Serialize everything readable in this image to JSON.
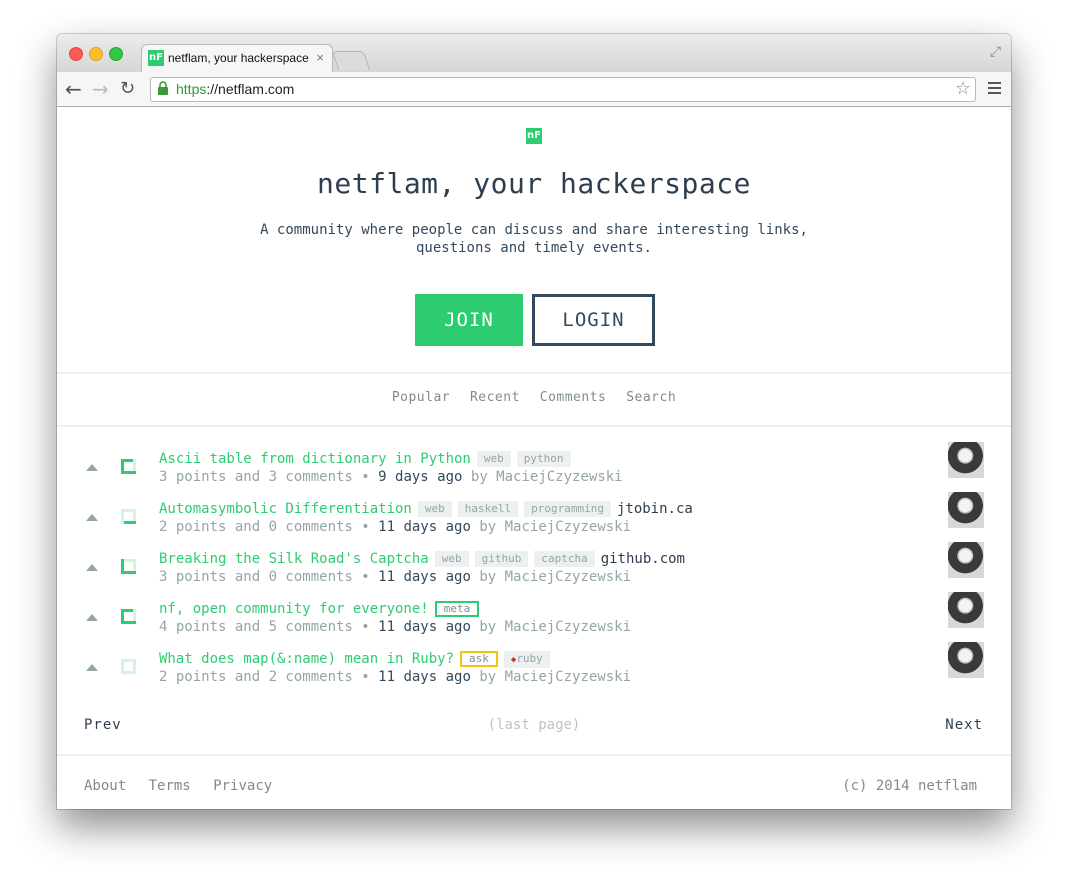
{
  "browser": {
    "tab_title": "netflam, your hackerspace",
    "tab_favicon": "nF",
    "tab_close": "×",
    "url_scheme": "https",
    "url_rest": "://netflam.com"
  },
  "hero": {
    "logo": "nF",
    "title": "netflam, your hackerspace",
    "tagline": "A community where people can discuss and share interesting links, questions and timely events.",
    "join_label": "JOIN",
    "login_label": "LOGIN"
  },
  "nav": [
    "Popular",
    "Recent",
    "Comments",
    "Search"
  ],
  "items": [
    {
      "title": "Ascii table from dictionary in Python",
      "tags": [
        "web",
        "python"
      ],
      "domain": "",
      "meta_prefix": "3 points and 3 comments •",
      "age": "9 days ago",
      "by": "by MaciejCzyzewski"
    },
    {
      "title": "Automasymbolic Differentiation",
      "tags": [
        "web",
        "haskell",
        "programming"
      ],
      "domain": "jtobin.ca",
      "meta_prefix": "2 points and 0 comments •",
      "age": "11 days ago",
      "by": "by MaciejCzyzewski"
    },
    {
      "title": "Breaking the Silk Road's Captcha",
      "tags": [
        "web",
        "github",
        "captcha"
      ],
      "domain": "github.com",
      "meta_prefix": "3 points and 0 comments •",
      "age": "11 days ago",
      "by": "by MaciejCzyzewski"
    },
    {
      "title": "nf, open community for everyone!",
      "tags": [
        "meta"
      ],
      "domain": "",
      "meta_prefix": "4 points and 5 comments •",
      "age": "11 days ago",
      "by": "by MaciejCzyzewski"
    },
    {
      "title": "What does map(&:name) mean in Ruby?",
      "tags": [
        "ask",
        "ruby"
      ],
      "domain": "",
      "meta_prefix": "2 points and 2 comments •",
      "age": "11 days ago",
      "by": "by MaciejCzyzewski"
    }
  ],
  "pager": {
    "prev": "Prev",
    "status": "(last page)",
    "next": "Next"
  },
  "footer": {
    "links": [
      "About",
      "Terms",
      "Privacy"
    ],
    "copyright": "(c) 2014 netflam"
  },
  "colors": {
    "accent": "#2ecc71",
    "text_dark": "#2c3e50",
    "muted": "#95a5a6"
  }
}
